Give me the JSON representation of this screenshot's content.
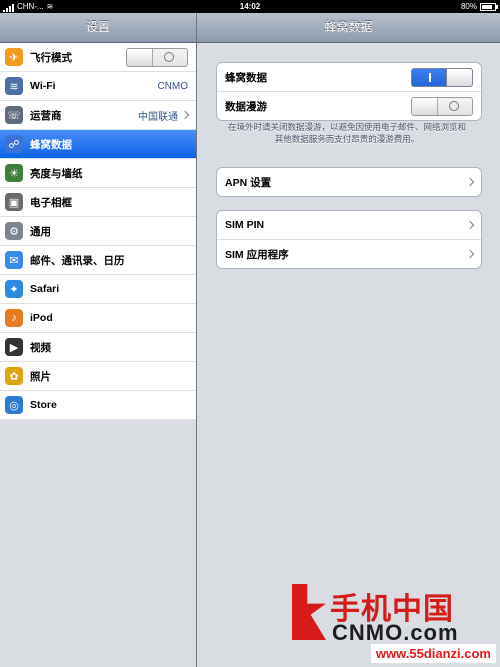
{
  "status_bar": {
    "carrier": "CHN-...",
    "time": "14:02",
    "battery": "80%",
    "battery_level": 0.8
  },
  "sidebar": {
    "title": "设置",
    "items": [
      {
        "label": "飞行模式",
        "icon": "airplane-icon",
        "color": "#f29a1c",
        "glyph": "✈",
        "accessory": "toggle-off"
      },
      {
        "label": "Wi-Fi",
        "icon": "wifi-icon",
        "color": "#4d6fa6",
        "glyph": "≋",
        "value": "CNMO"
      },
      {
        "label": "运营商",
        "icon": "phone-icon",
        "color": "#5f6b7a",
        "glyph": "☏",
        "value": "中国联通",
        "accessory": "chevron"
      },
      {
        "label": "蜂窝数据",
        "icon": "cellular-icon",
        "color": "#3a74d8",
        "glyph": "☍",
        "selected": true
      },
      {
        "label": "亮度与墙纸",
        "icon": "brightness-icon",
        "color": "#3f7e3d",
        "glyph": "☀"
      },
      {
        "label": "电子相框",
        "icon": "picture-frame-icon",
        "color": "#6b6b6b",
        "glyph": "▣"
      },
      {
        "label": "通用",
        "icon": "gear-icon",
        "color": "#7b8590",
        "glyph": "⚙"
      },
      {
        "label": "邮件、通讯录、日历",
        "icon": "mail-icon",
        "color": "#3c88e6",
        "glyph": "✉"
      },
      {
        "label": "Safari",
        "icon": "safari-icon",
        "color": "#2b8de0",
        "glyph": "✦"
      },
      {
        "label": "iPod",
        "icon": "ipod-icon",
        "color": "#e67c1f",
        "glyph": "♪"
      },
      {
        "label": "视频",
        "icon": "video-icon",
        "color": "#333333",
        "glyph": "▶"
      },
      {
        "label": "照片",
        "icon": "photos-icon",
        "color": "#e0a314",
        "glyph": "✿"
      },
      {
        "label": "Store",
        "icon": "store-icon",
        "color": "#2f7ad1",
        "glyph": "◎"
      }
    ]
  },
  "detail": {
    "title": "蜂窝数据",
    "group1": [
      {
        "label": "蜂窝数据",
        "state": "on"
      },
      {
        "label": "数据漫游",
        "state": "off"
      }
    ],
    "footnote": "在境外时请关闭数据漫游，以避免因使用电子邮件、网络浏览和其他数据服务而支付昂贵的漫游费用。",
    "apn": "APN 设置",
    "sim_pin": "SIM PIN",
    "sim_apps": "SIM 应用程序"
  },
  "watermark": {
    "brand_cn": "手机中国",
    "brand_en": "CNMO.com",
    "site": "www.55dianzi.com"
  }
}
